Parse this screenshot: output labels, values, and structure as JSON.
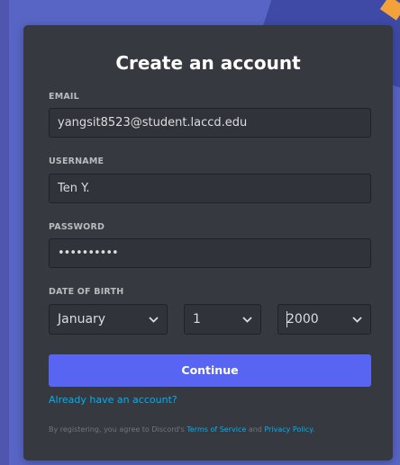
{
  "form": {
    "title": "Create an account",
    "email": {
      "label": "EMAIL",
      "value": "yangsit8523@student.laccd.edu"
    },
    "username": {
      "label": "USERNAME",
      "value": "Ten Y."
    },
    "password": {
      "label": "PASSWORD",
      "value": "••••••••••"
    },
    "dob": {
      "label": "DATE OF BIRTH",
      "month": "January",
      "day": "1",
      "year": "2000"
    },
    "continue_label": "Continue",
    "login_link": "Already have an account?",
    "terms": {
      "prefix": "By registering, you agree to Discord's ",
      "tos": "Terms of Service",
      "middle": " and ",
      "privacy": "Privacy Policy",
      "suffix": "."
    }
  },
  "colors": {
    "background": "#5865c4",
    "card": "#36393f",
    "input_bg": "#303339",
    "accent": "#5865f2",
    "link": "#00b0f4"
  },
  "icons": {
    "dropdown": "chevron-down-icon"
  }
}
